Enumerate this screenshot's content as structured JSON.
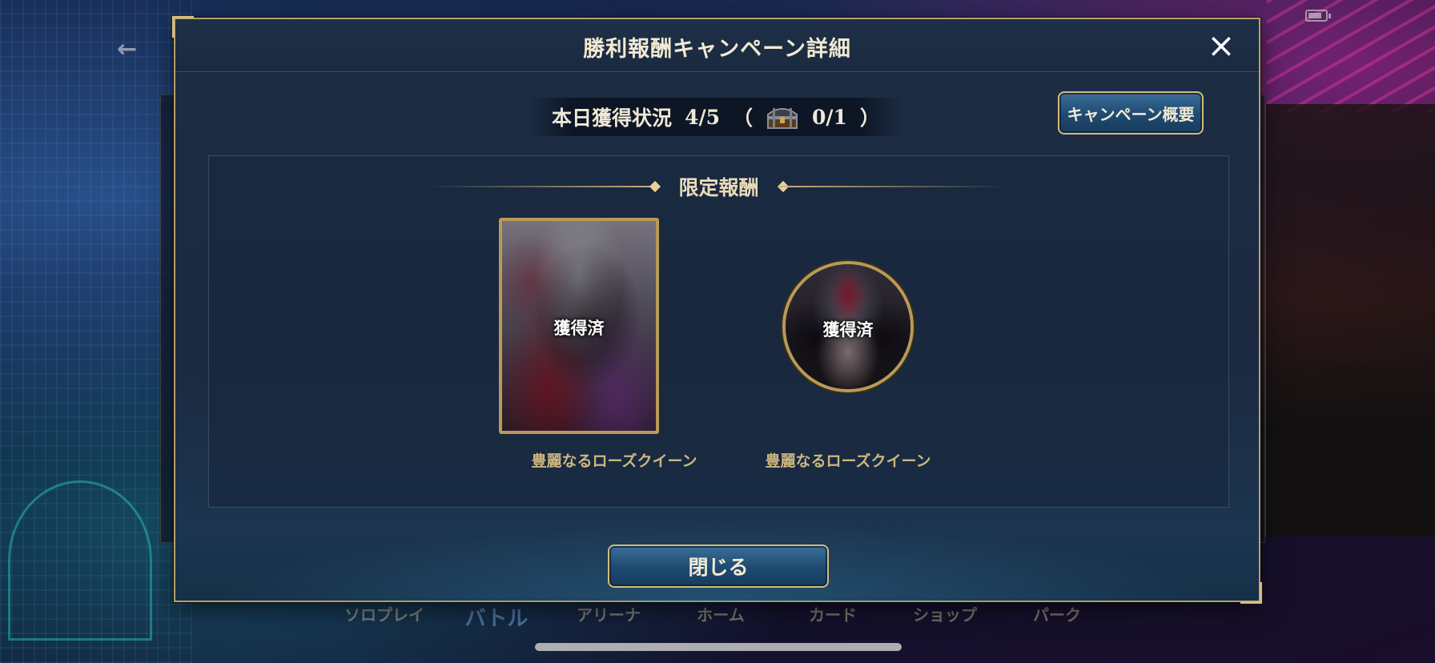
{
  "background": {
    "bottom_nav": [
      "ソロプレイ",
      "バトル",
      "アリーナ",
      "ホーム",
      "カード",
      "ショップ",
      "パーク"
    ]
  },
  "dialog": {
    "title": "勝利報酬キャンペーン詳細",
    "close_icon": "×",
    "status": {
      "label": "本日獲得状況",
      "wins": "4/5",
      "paren_open": "（",
      "chest_count": "0/1",
      "paren_close": "）",
      "chest_icon": "treasure-chest-icon"
    },
    "overview_button": "キャンペーン概要",
    "section_heading": "限定報酬",
    "rewards": [
      {
        "type": "card",
        "status": "獲得済",
        "name": "豊麗なるローズクイーン"
      },
      {
        "type": "emblem",
        "status": "獲得済",
        "name": "豊麗なるローズクイーン"
      }
    ],
    "close_button": "閉じる"
  },
  "colors": {
    "frame_gold": "#b8a16a",
    "button_blue": "#1e4a70",
    "name_gold": "#cdb77f"
  }
}
